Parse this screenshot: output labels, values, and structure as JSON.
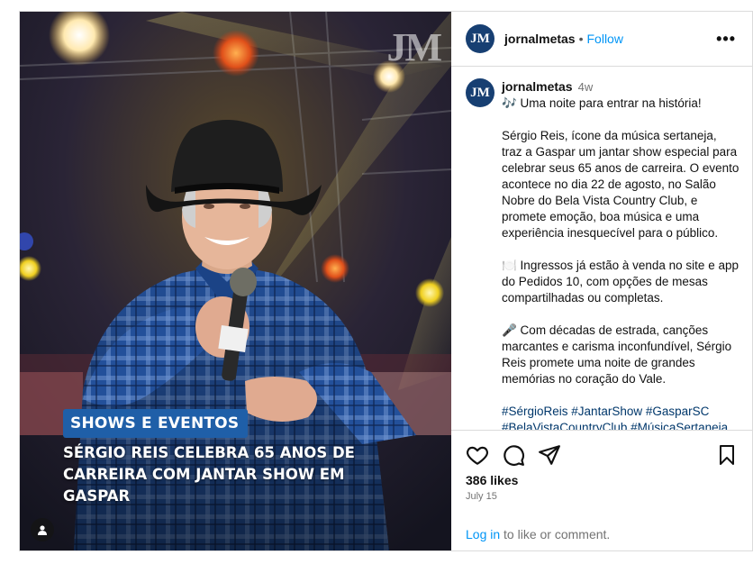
{
  "image": {
    "watermark": "JM",
    "category_tag": "SHOWS E EVENTOS",
    "headline": "SÉRGIO REIS CELEBRA 65 ANOS DE CARREIRA COM JANTAR SHOW EM GASPAR"
  },
  "header": {
    "avatar_text": "JM",
    "username": "jornalmetas",
    "separator": "•",
    "follow_label": "Follow",
    "more_label": "•••"
  },
  "caption": {
    "username": "jornalmetas",
    "age": "4w",
    "paragraphs": [
      "🎶 Uma noite para entrar na história!",
      "Sérgio Reis, ícone da música sertaneja, traz a Gaspar um jantar show especial para celebrar seus 65 anos de carreira. O evento acontece no dia 22 de agosto, no Salão Nobre do Bela Vista Country Club, e promete emoção, boa música e uma experiência inesquecível para o público.",
      "🍽️ Ingressos já estão à venda no site e app do Pedidos 10, com opções de mesas compartilhadas ou completas.",
      "🎤 Com décadas de estrada, canções marcantes e carisma inconfundível, Sérgio Reis promete uma noite de grandes memórias no coração do Vale."
    ],
    "hashtags": "#SérgioReis #JantarShow #GasparSC #BelaVistaCountryClub #MúsicaSertaneja"
  },
  "actions": {
    "icons": [
      "heart-icon",
      "comment-icon",
      "share-icon",
      "bookmark-icon"
    ],
    "likes": "386 likes",
    "date": "July 15",
    "login_link": "Log in",
    "login_rest": " to like or comment."
  },
  "colors": {
    "accent": "#0095f6",
    "tag_bg": "#1f5fa8",
    "avatar_bg": "#173f72"
  }
}
